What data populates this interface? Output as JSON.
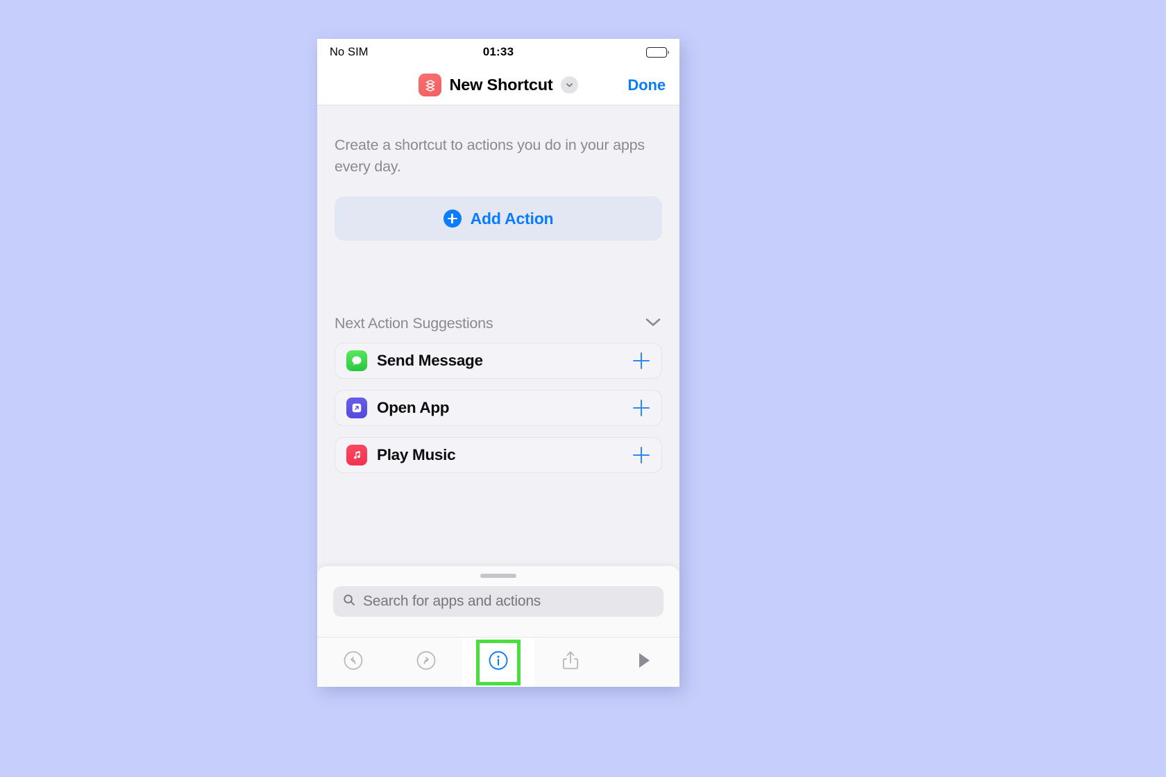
{
  "background": {
    "color": "#c6cefb"
  },
  "status_bar": {
    "carrier": "No SIM",
    "time": "01:33",
    "battery_icon": "battery-full-icon"
  },
  "nav_bar": {
    "app_icon": "shortcuts-app-icon",
    "title": "New Shortcut",
    "chevron_icon": "chevron-down-icon",
    "done_label": "Done",
    "accent_color": "#0a7cff"
  },
  "main": {
    "intro_text": "Create a shortcut to actions you do in your apps every day.",
    "add_action": {
      "label": "Add Action",
      "icon": "plus-circle-icon",
      "color": "#0a7cff"
    },
    "suggestions": {
      "title": "Next Action Suggestions",
      "collapse_icon": "chevron-down-icon",
      "items": [
        {
          "label": "Send Message",
          "icon": "messages-app-icon",
          "icon_color": "#25c53b",
          "add_icon": "plus-icon"
        },
        {
          "label": "Open App",
          "icon": "open-app-icon",
          "icon_color": "#5348dd",
          "add_icon": "plus-icon"
        },
        {
          "label": "Play Music",
          "icon": "music-app-icon",
          "icon_color": "#f5304f",
          "add_icon": "plus-icon"
        }
      ]
    }
  },
  "sheet": {
    "grabber": "sheet-grabber",
    "search": {
      "placeholder": "Search for apps and actions",
      "icon": "search-icon",
      "value": ""
    }
  },
  "toolbar": {
    "items": [
      {
        "name": "undo",
        "icon": "undo-icon",
        "highlighted": false
      },
      {
        "name": "redo",
        "icon": "redo-icon",
        "highlighted": false
      },
      {
        "name": "info",
        "icon": "info-circle-icon",
        "highlighted": true
      },
      {
        "name": "share",
        "icon": "share-icon",
        "highlighted": false
      },
      {
        "name": "play",
        "icon": "play-icon",
        "highlighted": false
      }
    ],
    "highlight_color": "#4ade3e"
  }
}
